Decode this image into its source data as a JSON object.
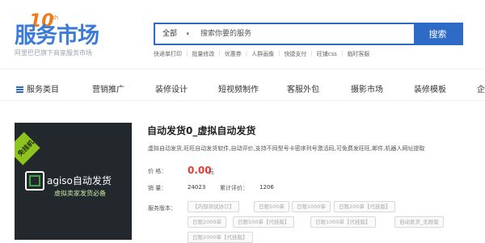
{
  "logo": {
    "main": "服务市场",
    "badge_number": "10",
    "badge_suffix": "th",
    "subtitle": "阿里巴巴旗下商家服务市场"
  },
  "search": {
    "category": "全部",
    "placeholder": "搜索你要的服务",
    "button_label": "搜索"
  },
  "hot_links": [
    "快递单打印",
    "批量修改",
    "优惠券",
    "人群画像",
    "快捷支付",
    "旺铺css",
    "临时客服"
  ],
  "nav": {
    "items": [
      "服务类目",
      "营销推广",
      "装修设计",
      "短视频制作",
      "客服外包",
      "摄影市场",
      "装修模板",
      "企"
    ]
  },
  "product": {
    "image": {
      "badge": "免挂机",
      "title": "agiso自动发货",
      "subtitle": "虚拟卖家发货必备"
    },
    "title": "自动发货0_虚拟自动发货",
    "description": "虚拟自动发货,旺旺自动发货软件,自动评价,支持不同型号卡密序列号激活码,可免费发旺旺,邮件,机器人网址提取",
    "price_label": "价    格：",
    "price": "0.00",
    "price_unit": "元",
    "sales_label": "销    量：",
    "sales": "24023",
    "reviews_label": "累计评价：",
    "reviews": "1206",
    "versions_label": "服务版本：",
    "versions": [
      "【内部测试协订】",
      "日限500单",
      "日限1000单",
      "日限200单【代挂版】",
      "日限2000单",
      "日限500单【代挂版】",
      "日限1000单【代挂版】",
      "自动发货_无限版",
      "日限2000单【代挂版】"
    ]
  },
  "colors": {
    "brand_blue": "#2d6bc6",
    "price_red": "#e93a2f",
    "accent_orange": "#f07a1a",
    "badge_green": "#8fc31f"
  }
}
